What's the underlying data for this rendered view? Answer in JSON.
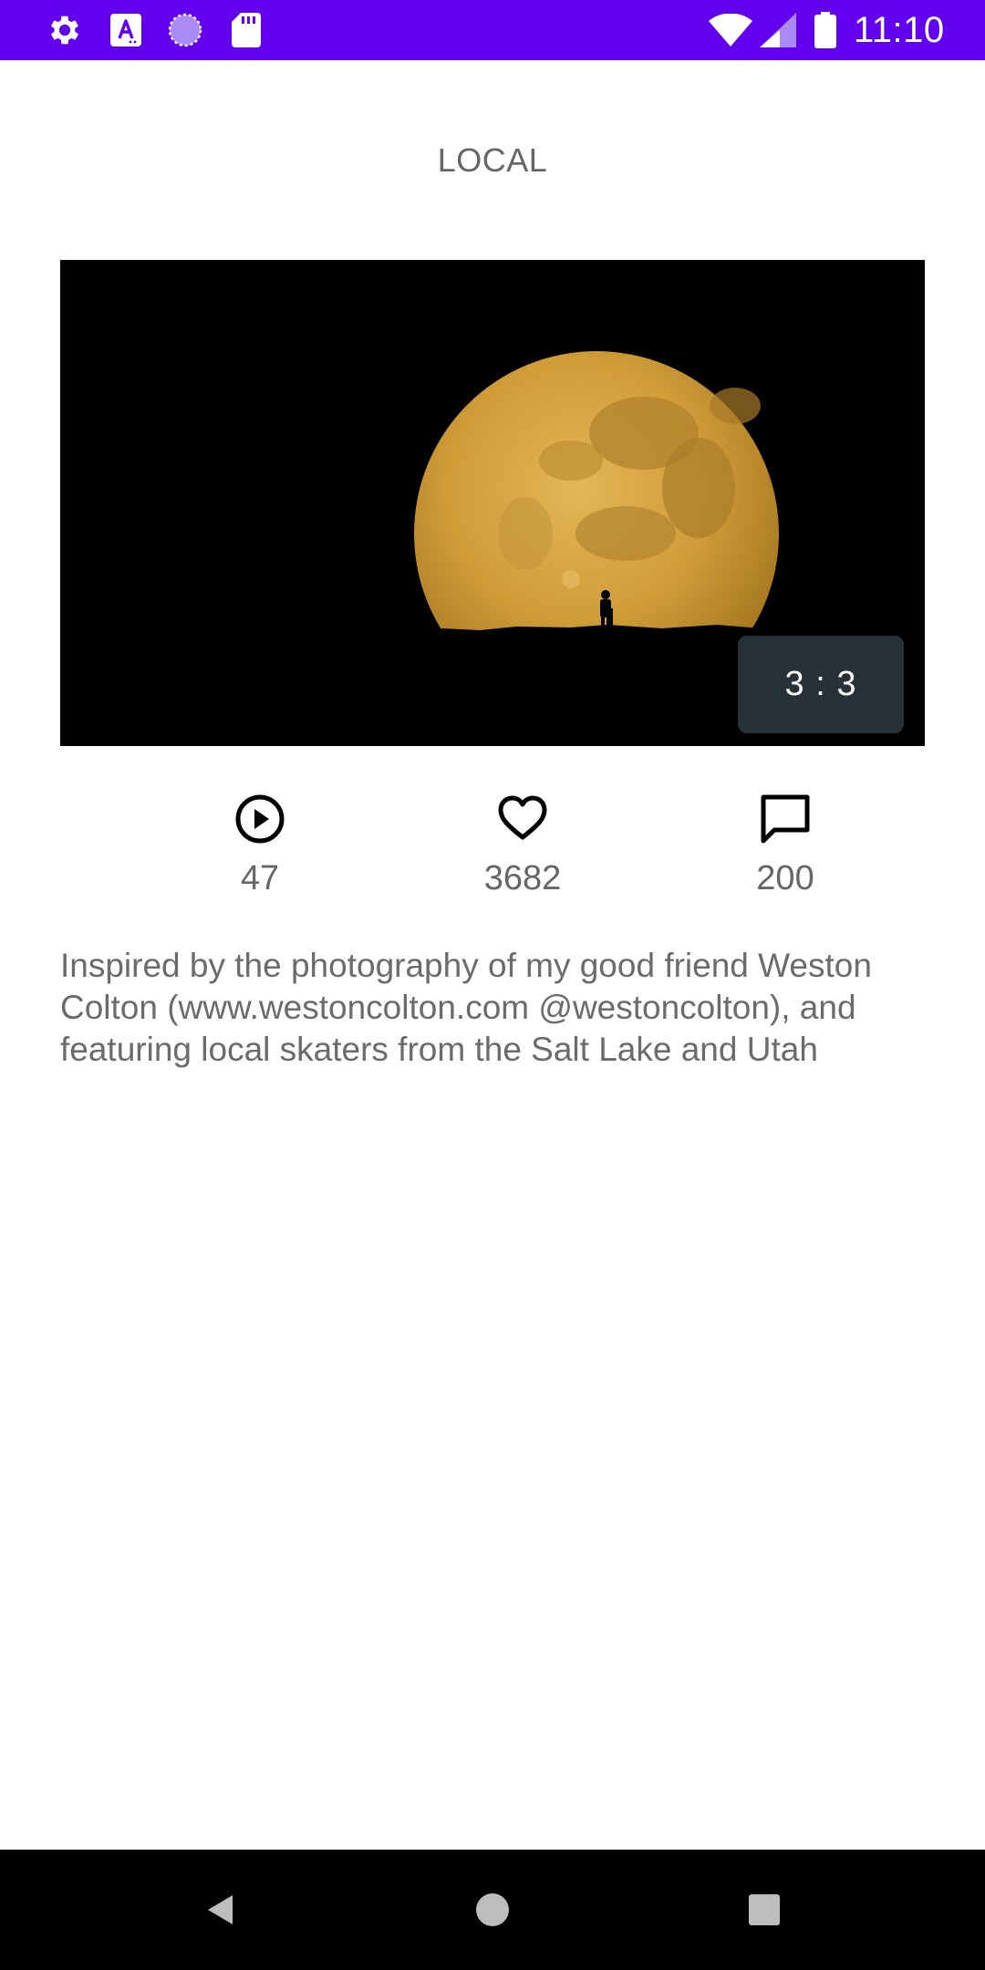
{
  "status_bar": {
    "time": "11:10",
    "icons": [
      "settings-icon",
      "text-a-icon",
      "loading-icon",
      "sd-card-icon",
      "wifi-icon",
      "signal-icon",
      "battery-icon"
    ]
  },
  "header": {
    "title": "LOCAL"
  },
  "video": {
    "thumbnail_icon": "moon-silhouette-image",
    "duration": "3 : 3"
  },
  "stats": {
    "views": "47",
    "likes": "3682",
    "comments": "200"
  },
  "description": "Inspired by the photography of my good friend Weston Colton (www.westoncolton.com @westoncolton), and featuring local skaters from the Salt Lake and Utah",
  "nav_bar": {
    "icons": [
      "back-icon",
      "home-icon",
      "recents-icon"
    ]
  },
  "colors": {
    "status_bar": "#6200ee",
    "text_secondary": "#666666",
    "badge_background": "#263238",
    "moon": "#d4a23c"
  }
}
